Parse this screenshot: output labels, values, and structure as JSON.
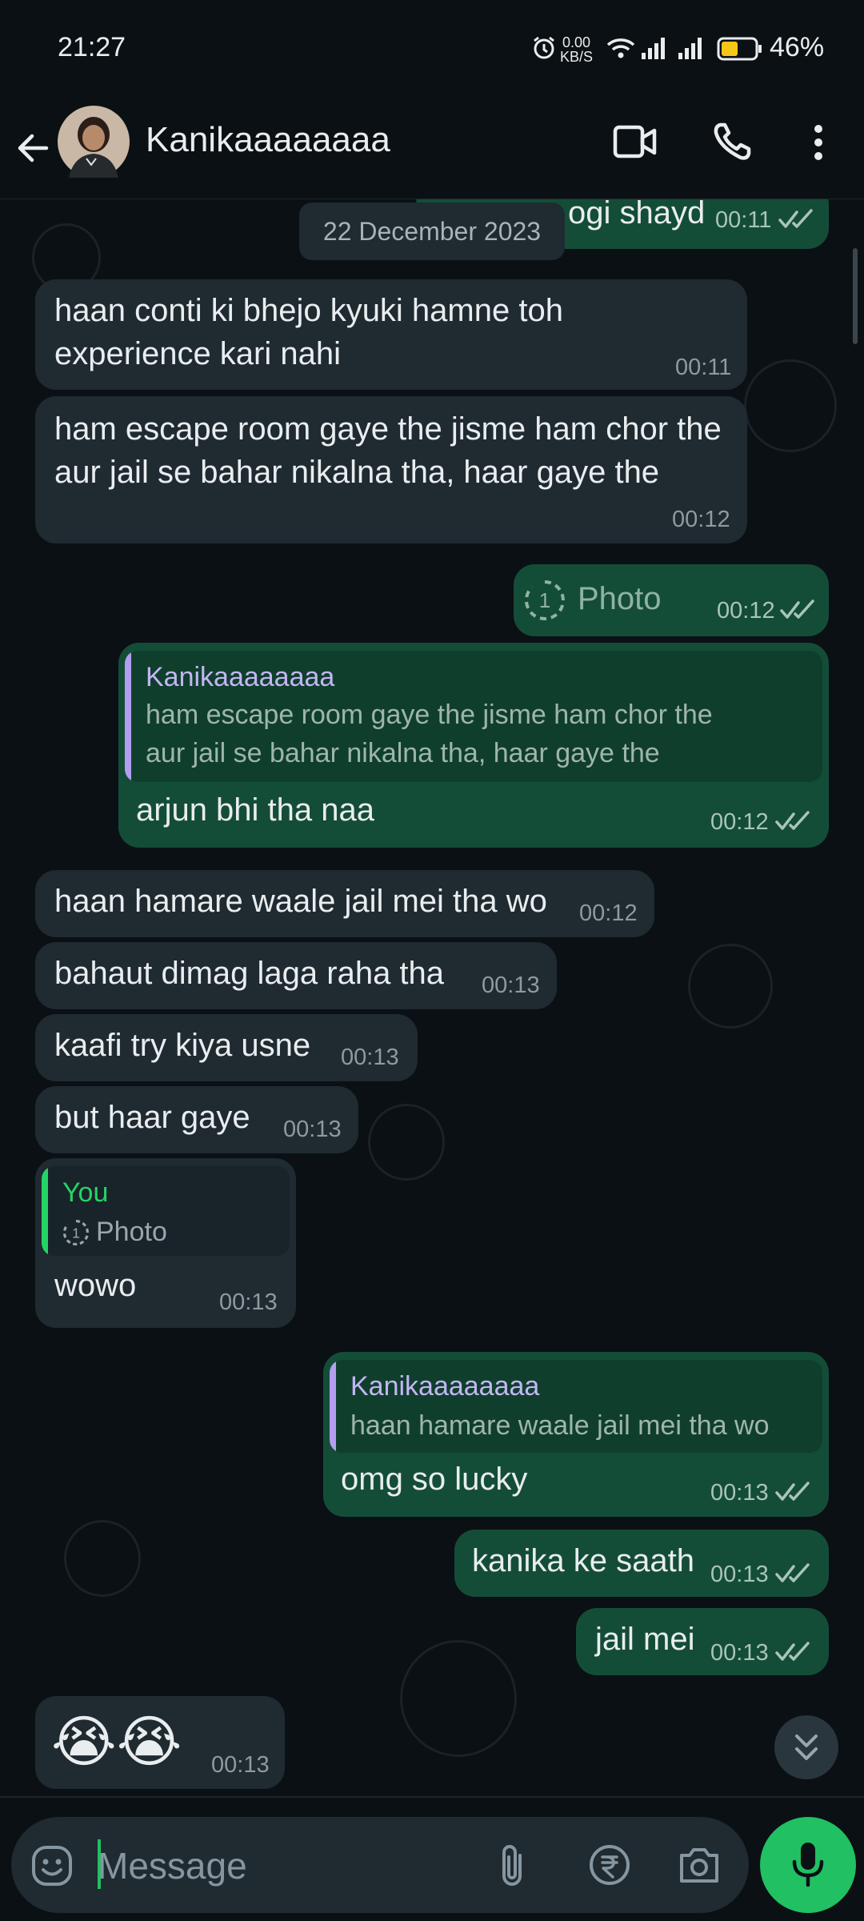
{
  "status_bar": {
    "time": "21:27",
    "net_speed_value": "0.00",
    "net_speed_unit": "KB/S",
    "battery_percent": "46%"
  },
  "header": {
    "contact_name": "Kanikaaaaaaaa"
  },
  "chat": {
    "date_label": "22 December 2023",
    "messages": [
      {
        "dir": "out",
        "text": "ogi shayd",
        "time": "00:11"
      },
      {
        "dir": "in",
        "text_line1": "haan conti ki bhejo kyuki hamne toh",
        "text_line2": "experience kari nahi",
        "time": "00:11"
      },
      {
        "dir": "in",
        "text_line1": "ham escape room gaye the jisme ham chor the",
        "text_line2": "aur jail se bahar nikalna tha, haar gaye the",
        "time": "00:12"
      },
      {
        "dir": "out",
        "text": "Photo",
        "time": "00:12"
      },
      {
        "dir": "out",
        "quote_name": "Kanikaaaaaaaa",
        "quote_line1": "ham escape room gaye the jisme ham chor the",
        "quote_line2": "aur jail se bahar nikalna tha, haar gaye the",
        "text": "arjun bhi tha naa",
        "time": "00:12"
      },
      {
        "dir": "in",
        "text": "haan hamare waale jail mei tha wo",
        "time": "00:12"
      },
      {
        "dir": "in",
        "text": "bahaut dimag laga raha tha",
        "time": "00:13"
      },
      {
        "dir": "in",
        "text": "kaafi try kiya usne",
        "time": "00:13"
      },
      {
        "dir": "in",
        "text": "but haar gaye",
        "time": "00:13"
      },
      {
        "dir": "in",
        "quote_name": "You",
        "quote_text": "Photo",
        "text": "wowo",
        "time": "00:13"
      },
      {
        "dir": "out",
        "quote_name": "Kanikaaaaaaaa",
        "quote_text": "haan hamare waale jail mei tha wo",
        "text": "omg so lucky",
        "time": "00:13"
      },
      {
        "dir": "out",
        "text": "kanika ke saath",
        "time": "00:13"
      },
      {
        "dir": "out",
        "text": "jail mei",
        "time": "00:13"
      },
      {
        "dir": "in",
        "text": "😭😭",
        "time": "00:13"
      }
    ]
  },
  "input": {
    "placeholder": "Message"
  },
  "icons": {
    "back": "arrow-left-icon",
    "video": "video-call-icon",
    "call": "phone-icon",
    "menu": "more-vert-icon",
    "emoji": "emoji-icon",
    "attach": "paperclip-icon",
    "payment": "rupee-icon",
    "camera": "camera-icon",
    "mic": "mic-icon",
    "scroll": "double-chevron-down-icon"
  },
  "colors": {
    "background": "#0b1014",
    "incoming_bubble": "#1f2a31",
    "outgoing_bubble": "#144d37",
    "accent_green": "#21c063",
    "read_ticks": "#a9c5b8",
    "quote_name_purple": "#c4b5f5",
    "quote_name_you": "#25d366"
  }
}
